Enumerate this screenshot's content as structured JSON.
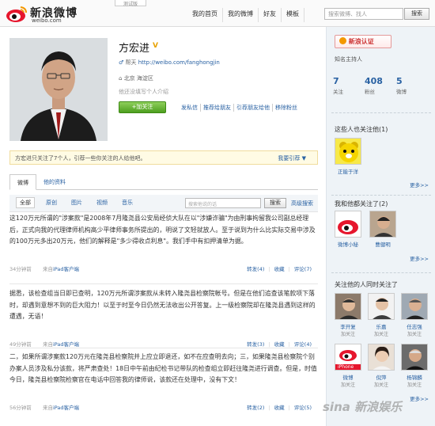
{
  "header": {
    "logo_text": "新浪微博",
    "logo_url": "weibo.com",
    "beta_label": "测试版",
    "nav": [
      "我的首页",
      "我的微博",
      "好友",
      "模板"
    ],
    "search_placeholder": "搜索微博、找人",
    "search_button": "搜索"
  },
  "profile": {
    "name": "方宏进",
    "verified_mark": "V",
    "url_label": "帮天",
    "url": "http://weibo.com/fanghongjin",
    "location": "北京 海淀区",
    "bio": "他还没填写个人介绍",
    "follow_button": "+加关注",
    "actions": [
      "发私信",
      "推荐给朋友",
      "引荐朋友给他",
      "移除粉丝"
    ]
  },
  "notice": {
    "text": "方宏进只关注了7个人，引荐一些你关注的人给他吧。",
    "link": "我要引荐 ▼"
  },
  "tabs": [
    "微博",
    "他的资料"
  ],
  "filters": {
    "items": [
      "全部",
      "原创",
      "图片",
      "视频",
      "音乐"
    ],
    "search_placeholder": "搜索他说的话",
    "search_button": "搜索",
    "advanced": "高级搜索"
  },
  "posts": [
    {
      "text": "这120万元所谓的\"涉案款\"是2008年7月隆尧县公安局经侦大队在以\"涉嫌诈骗\"为由刑事拘留我公司副总经理后，正式向我的代理律师机构高少平律师事务所提出的，明说了文轻就放人。至于说到为什么比实际交易中涉及的100万元多出20万元，他们的解释是\"多少得收点利息\"。我们手中有扣押清单为据。",
      "time": "34分钟前",
      "source_prefix": "来自",
      "source": "iPad客户端",
      "repost": "转发(4)",
      "favorite": "收藏",
      "comment": "评论(7)"
    },
    {
      "text": "据悉，该检查组当日即已查明，120万元所谓涉案款从未转入隆尧县检察院帐号。但是在他们追查该笔款项下落时，却遇到意想不到的巨大阻力！以至于时至今日仍然无法收出公开答复。上一级检察院却在隆尧县遇到这样的遭遇，无语！",
      "time": "49分钟前",
      "source_prefix": "来自",
      "source": "iPad客户端",
      "repost": "转发(3)",
      "favorite": "收藏",
      "comment": "评论(4)"
    },
    {
      "text": "二，如果所谓涉案款120万元在隆尧县检察院并上应立即退还，如不在应查明去向；三，如果隆尧县检察院个别办案人员涉及私分该款，将严肃查处！18日中午前由纪检书记带队的检查组立即赶往隆尧进行调查。但是，时值今日，隆尧县检察院检察官在电话中回答我的律师说，该款还在处理中，没有下文！",
      "time": "56分钟前",
      "source_prefix": "来自",
      "source": "iPad客户端",
      "repost": "转发(2)",
      "favorite": "收藏",
      "comment": "评论(5)"
    }
  ],
  "sidebar": {
    "verify_button": "新浪认证",
    "verify_desc": "知名主持人",
    "stats": [
      {
        "num": "7",
        "label": "关注"
      },
      {
        "num": "408",
        "label": "粉丝"
      },
      {
        "num": "5",
        "label": "微博"
      }
    ],
    "also_follow_title": "这些人也关注他(1)",
    "also_follow_users": [
      {
        "name": "正能于洋"
      }
    ],
    "more": "更多>>",
    "mutual_title": "我和他都关注了(2)",
    "mutual_users": [
      {
        "name": "微博小秘"
      },
      {
        "name": "曹健明"
      }
    ],
    "common_title": "关注他的人同时关注了",
    "common_users": [
      {
        "name": "李开复",
        "sub": "加关注"
      },
      {
        "name": "乐嘉",
        "sub": "加关注"
      },
      {
        "name": "任志强",
        "sub": "加关注"
      },
      {
        "name": "微博",
        "sub": "加关注"
      },
      {
        "name": "倪萍",
        "sub": "加关注"
      },
      {
        "name": "杨锦麟",
        "sub": "加关注"
      }
    ],
    "iphone_label": "iPhone"
  },
  "watermark": "sina 新浪娱乐",
  "colors": {
    "link": "#2a62a3",
    "accent_red": "#c33",
    "follow_green": "#4d9f1f",
    "sidebar_bg": "#eef3f7"
  }
}
